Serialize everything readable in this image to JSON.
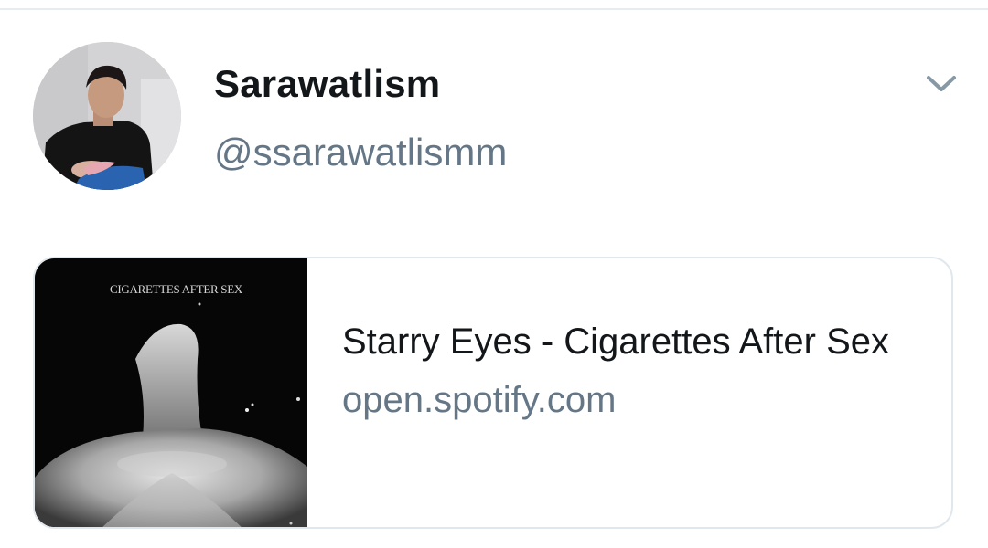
{
  "tweet": {
    "display_name": "Sarawatlism",
    "handle": "@ssarawatlismm",
    "avatar_icon": "profile-photo",
    "menu_icon": "chevron-down-icon"
  },
  "card": {
    "image_text": "CIGARETTES AFTER SEX",
    "title": "Starry Eyes - Cigarettes After Sex",
    "domain": "open.spotify.com"
  },
  "colors": {
    "name": "#14171a",
    "secondary": "#657786",
    "border": "#e1e8ed",
    "chevron": "#8899a6"
  }
}
